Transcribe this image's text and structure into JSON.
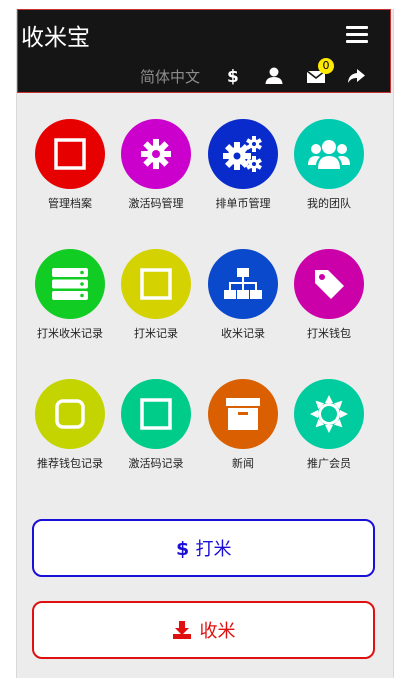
{
  "header": {
    "title": "收米宝",
    "language": "简体中文",
    "message_badge": "0"
  },
  "tiles": [
    {
      "label": "管理档案",
      "color": "#e60000",
      "icon": "square-outline-icon"
    },
    {
      "label": "激活码管理",
      "color": "#cc00cc",
      "icon": "gear-icon"
    },
    {
      "label": "排单币管理",
      "color": "#0a2bcc",
      "icon": "gears-icon"
    },
    {
      "label": "我的团队",
      "color": "#00cbb0",
      "icon": "users-icon"
    },
    {
      "label": "打米收米记录",
      "color": "#11cc22",
      "icon": "server-icon"
    },
    {
      "label": "打米记录",
      "color": "#d4d200",
      "icon": "square-outline-icon"
    },
    {
      "label": "收米记录",
      "color": "#0a48cc",
      "icon": "sitemap-icon"
    },
    {
      "label": "打米钱包",
      "color": "#cc00a8",
      "icon": "tag-icon"
    },
    {
      "label": "推荐钱包记录",
      "color": "#c4d400",
      "icon": "rounded-square-icon"
    },
    {
      "label": "激活码记录",
      "color": "#00cc8a",
      "icon": "square-outline-icon"
    },
    {
      "label": "新闻",
      "color": "#d95f00",
      "icon": "archive-icon"
    },
    {
      "label": "推广会员",
      "color": "#00cca0",
      "icon": "sun-icon"
    }
  ],
  "buttons": {
    "send_label": "打米",
    "send_color": "#1a0fd6",
    "receive_label": "收米",
    "receive_color": "#e01010"
  }
}
